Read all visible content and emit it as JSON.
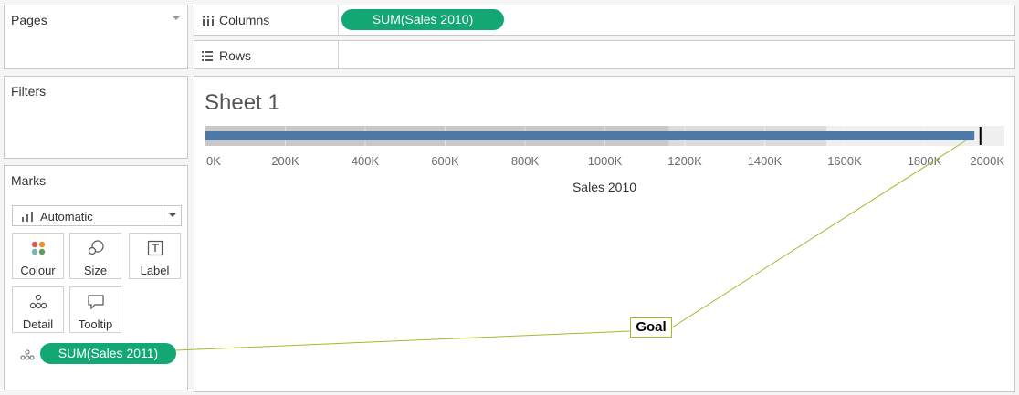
{
  "left_panel": {
    "pages_title": "Pages",
    "filters_title": "Filters",
    "marks_title": "Marks",
    "marks_type": "Automatic",
    "cards": [
      {
        "label": "Colour",
        "icon": "color-dots-icon"
      },
      {
        "label": "Size",
        "icon": "size-icon"
      },
      {
        "label": "Label",
        "icon": "text-icon"
      },
      {
        "label": "Detail",
        "icon": "detail-icon"
      },
      {
        "label": "Tooltip",
        "icon": "tooltip-icon"
      }
    ],
    "marks_pill": "SUM(Sales 2011)"
  },
  "shelves": {
    "columns_label": "Columns",
    "columns_pill": "SUM(Sales 2010)",
    "rows_label": "Rows"
  },
  "sheet": {
    "title": "Sheet 1"
  },
  "annotation": {
    "label": "Goal",
    "color": "#9bbf2a"
  },
  "colors": {
    "pill": "#13a774",
    "bar": "#4e79a7",
    "band_dark": "#c8c8c8",
    "band_light": "#dcdcdc",
    "band_lightest": "#efefef"
  },
  "chart_data": {
    "type": "bar",
    "orientation": "horizontal",
    "xlabel": "Sales 2010",
    "xlim": [
      0,
      2000000
    ],
    "tick_values": [
      0,
      200000,
      400000,
      600000,
      800000,
      1000000,
      1200000,
      1400000,
      1600000,
      1800000,
      2000000
    ],
    "tick_labels": [
      "0K",
      "200K",
      "400K",
      "600K",
      "800K",
      "1000K",
      "1200K",
      "1400K",
      "1600K",
      "1800K",
      "2000K"
    ],
    "bar_value": 1925000,
    "reference_line_value": 1940000,
    "distribution_bands": [
      {
        "from": 0,
        "to": 1160000,
        "shade": "dark"
      },
      {
        "from": 1160000,
        "to": 1555000,
        "shade": "light"
      },
      {
        "from": 1555000,
        "to": 2000000,
        "shade": "lightest"
      }
    ]
  }
}
